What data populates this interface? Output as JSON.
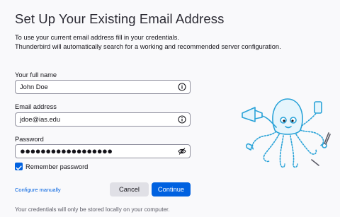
{
  "page": {
    "title": "Set Up Your Existing Email Address",
    "intro_line1": "To use your current email address fill in your credentials.",
    "intro_line2": "Thunderbird will automatically search for a working and recommended server configuration."
  },
  "form": {
    "name_label": "Your full name",
    "name_value": "John Doe",
    "email_label": "Email address",
    "email_value": "jdoe@ias.edu",
    "password_label": "Password",
    "password_value": "●●●●●●●●●●●●●●●●●●",
    "remember_label": "Remember password",
    "remember_checked": true
  },
  "actions": {
    "configure_manually": "Configure manually",
    "cancel": "Cancel",
    "continue": "Continue"
  },
  "footer": {
    "note": "Your credentials will only be stored locally on your computer."
  },
  "icons": {
    "info": "info-icon",
    "eye": "eye-slash-icon",
    "check": "checkmark-icon",
    "mascot": "octopus-mascot-icon"
  },
  "colors": {
    "accent": "#0061e0",
    "background": "#f9f9fb",
    "mascot": "#2aa3d8"
  }
}
